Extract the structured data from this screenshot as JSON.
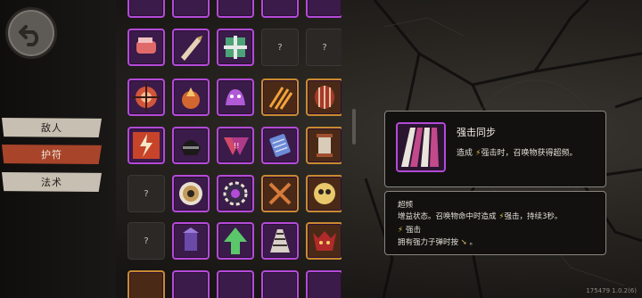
{
  "tabs": [
    {
      "label": "敌人"
    },
    {
      "label": "护符"
    },
    {
      "label": "法术"
    }
  ],
  "grid": {
    "unknown_label": "?"
  },
  "info": {
    "title": "强击同步",
    "desc_prefix": "造成",
    "desc_keyword": "强击时，召唤物获得超频。"
  },
  "detail": {
    "term1": "超频",
    "term1_desc_a": "增益状态。召唤物命中时造成",
    "term1_desc_b": "强击，持续3秒。",
    "term2": "强击",
    "term2_desc": "拥有强力子弹时按",
    "term2_desc_end": "。"
  },
  "version": "175479 1.0.2(6)",
  "colors": {
    "charm_border": "#b44ad8",
    "gold_border": "#c98a2f",
    "active_tab": "#a8442a"
  },
  "icons": [
    "back-arrow-icon",
    "charm-icons",
    "strike-icon",
    "bullet-icon"
  ]
}
